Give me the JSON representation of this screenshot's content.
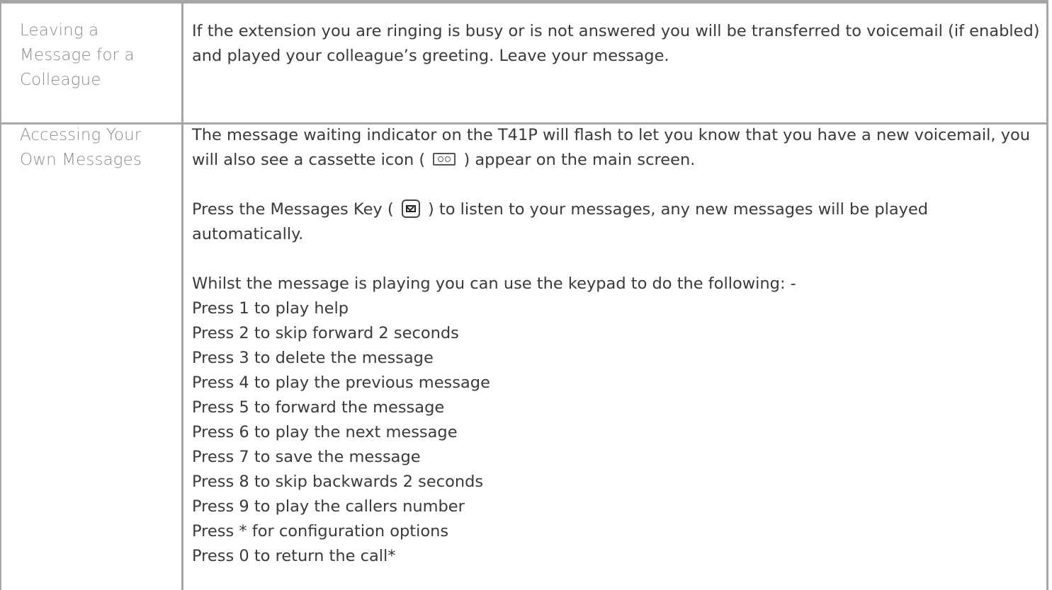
{
  "rows": [
    {
      "label": "Leaving a Message for a Colleague",
      "text": "If the extension you are ringing is busy or is not answered you will be transferred to voicemail (if enabled) and played your colleague’s greeting. Leave your message."
    },
    {
      "label": "Accessing Your Own Messages",
      "para1_before": "The message waiting indicator on the T41P will flash to let you know that you have a new voicemail, you will also see a cassette icon (",
      "para1_after": ") appear on the main screen.",
      "para2_before": "Press the Messages Key (",
      "para2_after": ") to listen to your messages, any  new messages will be played automatically.",
      "intro": "Whilst the message is playing you can use the keypad to do the following: -",
      "items": [
        "Press 1 to play help",
        "Press 2 to skip forward 2 seconds",
        "Press 3 to delete the message",
        "Press 4 to play the previous message",
        "Press 5 to forward the message",
        "Press 6 to play the next message",
        "Press 7 to save the message",
        "Press 8 to skip backwards 2 seconds",
        "Press 9 to play the callers number",
        "Press * for configuration options",
        "Press 0 to return the call*"
      ]
    }
  ],
  "icons": {
    "cassette": "cassette-icon",
    "messages_key": "envelope-key-icon"
  }
}
